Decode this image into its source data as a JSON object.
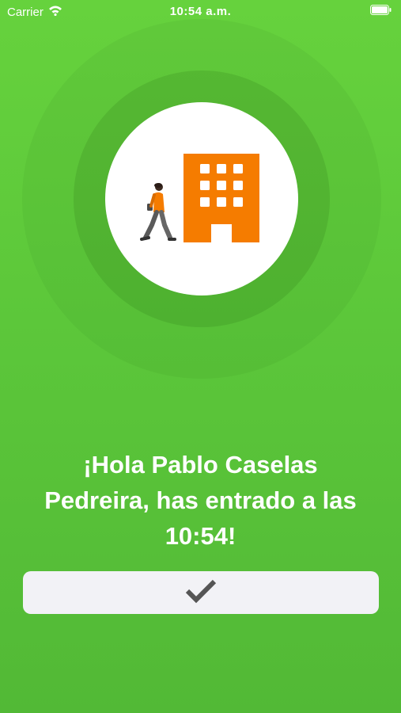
{
  "status_bar": {
    "carrier": "Carrier",
    "time": "10:54 a.m.",
    "wifi_icon": "wifi-icon",
    "battery_icon": "battery-icon"
  },
  "illustration": {
    "icon": "person-walking-to-building-icon",
    "colors": {
      "building": "#f57c00",
      "person_shirt": "#f57c00",
      "person_pants": "#555555"
    }
  },
  "message": {
    "line1": "¡Hola Pablo Caselas",
    "line2": "Pedreira, has entrado a las",
    "line3": "10:54!"
  },
  "confirm_button": {
    "icon": "checkmark-icon"
  },
  "colors": {
    "background": "#5cc73a",
    "button_bg": "#f2f2f6",
    "check": "#555555"
  }
}
